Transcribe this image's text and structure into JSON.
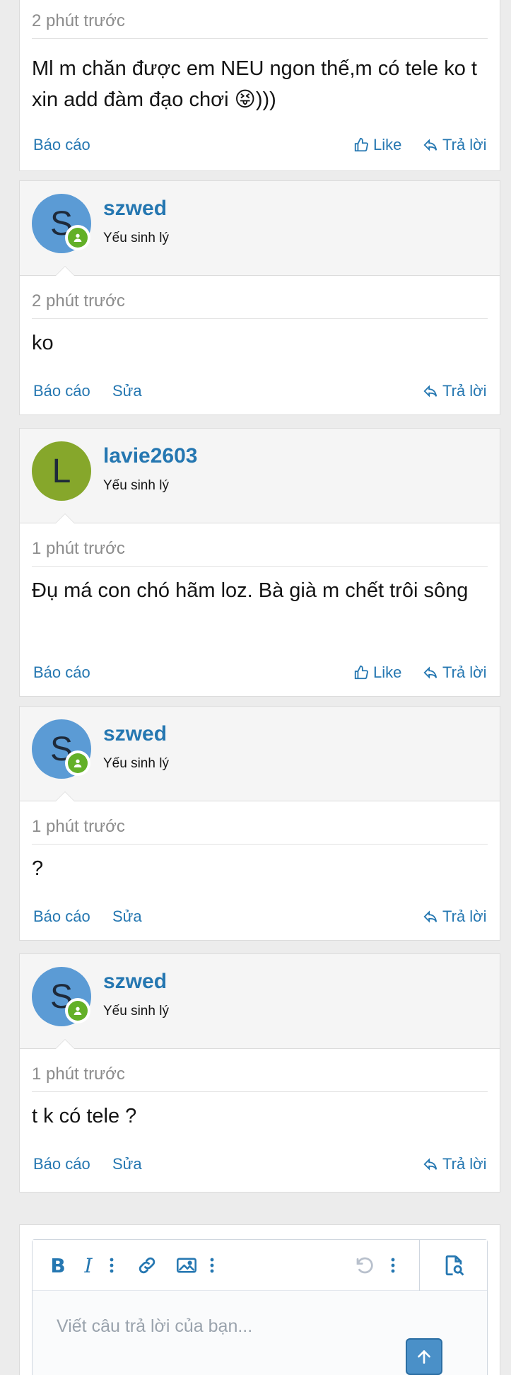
{
  "posts": [
    {
      "time": "2 phút trước",
      "message": "Ml m chăn được em NEU ngon thế,m có tele ko t xin add đàm đạo chơi 😝)))",
      "report": "Báo cáo",
      "like": "Like",
      "reply": "Trả lời"
    },
    {
      "avatar_letter": "S",
      "avatar_color": "#5b9bd5",
      "username": "szwed",
      "user_title": "Yếu sinh lý",
      "time": "2 phút trước",
      "message": "ko",
      "report": "Báo cáo",
      "edit": "Sửa",
      "reply": "Trả lời"
    },
    {
      "avatar_letter": "L",
      "avatar_color": "#86a72b",
      "username": "lavie2603",
      "user_title": "Yếu sinh lý",
      "time": "1 phút trước",
      "message": "Đụ má con chó hãm loz. Bà già m chết trôi sông",
      "report": "Báo cáo",
      "like": "Like",
      "reply": "Trả lời"
    },
    {
      "avatar_letter": "S",
      "avatar_color": "#5b9bd5",
      "username": "szwed",
      "user_title": "Yếu sinh lý",
      "time": "1 phút trước",
      "message": "?",
      "report": "Báo cáo",
      "edit": "Sửa",
      "reply": "Trả lời"
    },
    {
      "avatar_letter": "S",
      "avatar_color": "#5b9bd5",
      "username": "szwed",
      "user_title": "Yếu sinh lý",
      "time": "1 phút trước",
      "message": "t k có tele ?",
      "report": "Báo cáo",
      "edit": "Sửa",
      "reply": "Trả lời"
    }
  ],
  "composer": {
    "placeholder": "Viết câu trả lời của bạn...",
    "toolbar_icons": [
      "bold-icon",
      "italic-icon",
      "more-options-icon",
      "link-icon",
      "image-icon",
      "more-options-icon",
      "undo-icon",
      "more-options-icon",
      "preview-icon"
    ]
  },
  "colors": {
    "link": "#2577b1",
    "online": "#63b028",
    "background": "#ececec"
  }
}
